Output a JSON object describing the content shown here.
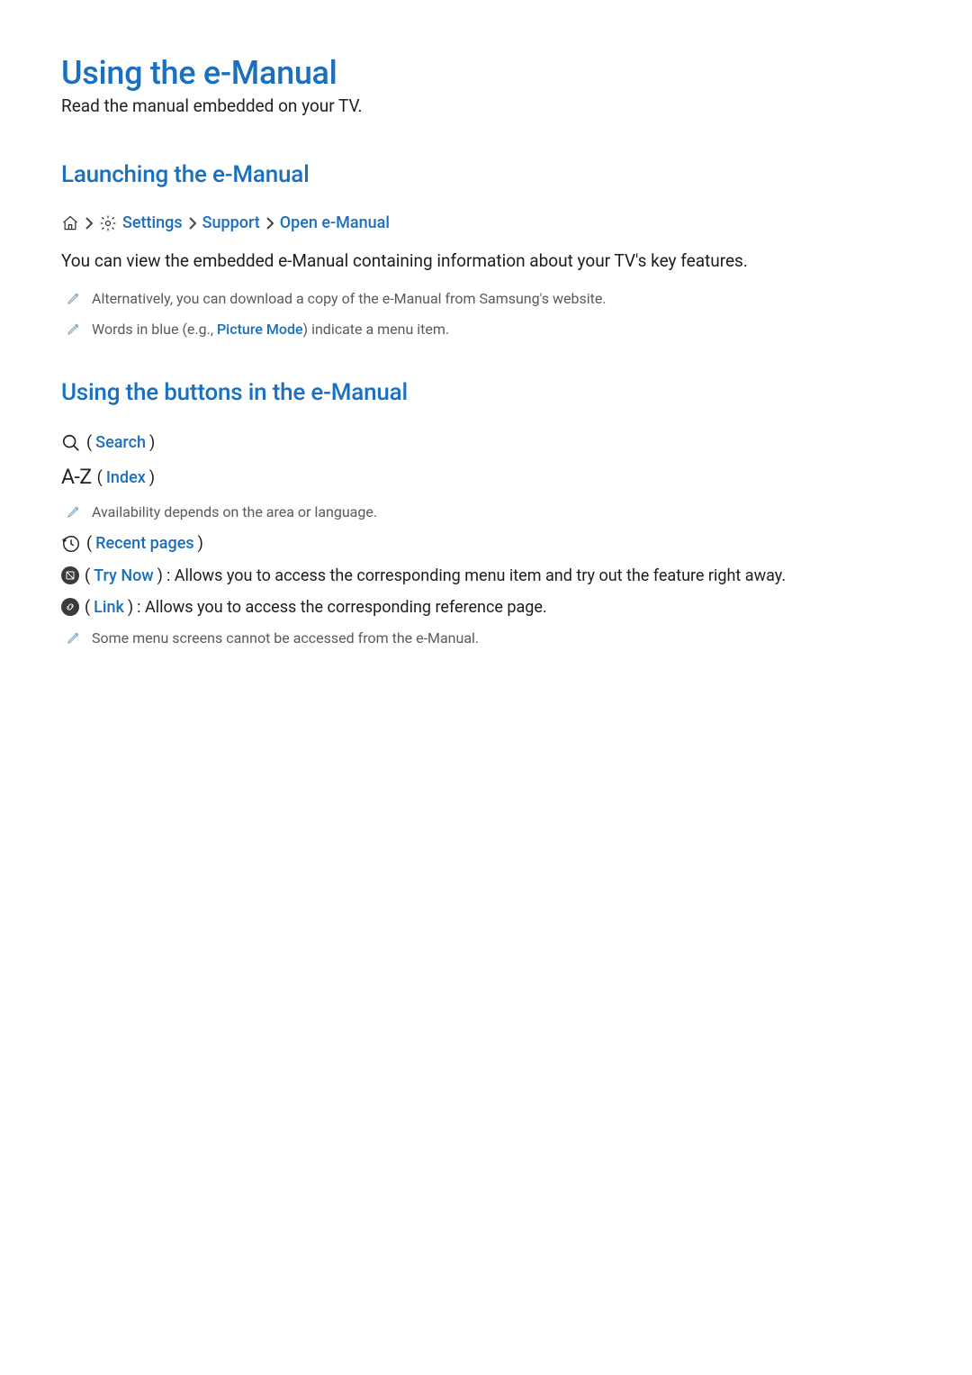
{
  "title": "Using the e-Manual",
  "subtitle": "Read the manual embedded on your TV.",
  "section1": {
    "heading": "Launching the e-Manual",
    "breadcrumb": {
      "settings": "Settings",
      "support": "Support",
      "open": "Open e-Manual"
    },
    "para": "You can view the embedded e-Manual containing information about your TV's key features.",
    "notes": {
      "n1": "Alternatively, you can download a copy of the e-Manual from Samsung's website.",
      "n2_pre": "Words in blue (e.g., ",
      "n2_link": "Picture Mode",
      "n2_post": ") indicate a menu item."
    }
  },
  "section2": {
    "heading": "Using the buttons in the e-Manual",
    "search_label": "Search",
    "index_label": "Index",
    "availability_note": "Availability depends on the area or language.",
    "recent_label": "Recent pages",
    "trynow_label": "Try Now",
    "trynow_desc": ": Allows you to access the corresponding menu item and try out the feature right away.",
    "link_label": "Link",
    "link_desc": ": Allows you to access the corresponding reference page.",
    "access_note": "Some menu screens cannot be accessed from the e-Manual."
  }
}
